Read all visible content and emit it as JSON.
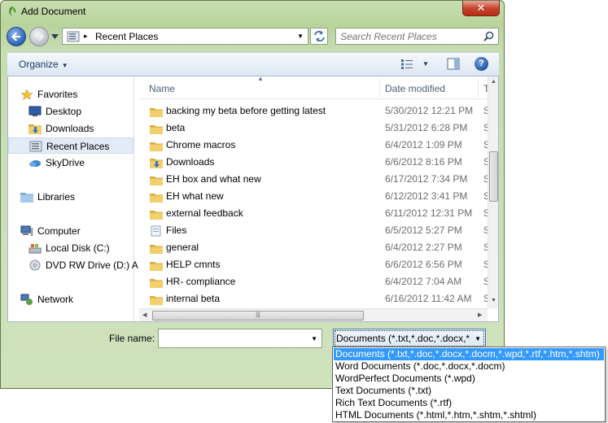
{
  "window": {
    "title": "Add Document",
    "close_label": "✕"
  },
  "address": {
    "path": "Recent Places",
    "separator": "▸"
  },
  "search": {
    "placeholder": "Search Recent Places"
  },
  "toolbar": {
    "organize_label": "Organize",
    "help_label": "?"
  },
  "nav": {
    "items": [
      {
        "label": "Favorites",
        "icon": "star-icon"
      },
      {
        "label": "Desktop",
        "icon": "desktop-icon"
      },
      {
        "label": "Downloads",
        "icon": "downloads-folder-icon"
      },
      {
        "label": "Recent Places",
        "icon": "recent-places-icon",
        "selected": true
      },
      {
        "label": "SkyDrive",
        "icon": "skydrive-icon"
      },
      {
        "label": "Libraries",
        "icon": "libraries-icon"
      },
      {
        "label": "Computer",
        "icon": "computer-icon"
      },
      {
        "label": "Local Disk (C:)",
        "icon": "local-disk-icon"
      },
      {
        "label": "DVD RW Drive (D:) A",
        "icon": "dvd-drive-icon"
      },
      {
        "label": "Network",
        "icon": "network-icon"
      }
    ]
  },
  "columns": {
    "name": "Name",
    "date": "Date modified",
    "type": "T"
  },
  "files": [
    {
      "name": "backing my beta before getting latest",
      "date": "5/30/2012 12:21 PM",
      "type": "S",
      "icon": "folder-icon"
    },
    {
      "name": "beta",
      "date": "5/31/2012 6:28 PM",
      "type": "S",
      "icon": "folder-icon"
    },
    {
      "name": "Chrome macros",
      "date": "6/4/2012 1:09 PM",
      "type": "S",
      "icon": "folder-icon"
    },
    {
      "name": "Downloads",
      "date": "6/6/2012 8:16 PM",
      "type": "S",
      "icon": "downloads-folder-icon"
    },
    {
      "name": "EH box and what new",
      "date": "6/17/2012 7:34 PM",
      "type": "S",
      "icon": "folder-icon"
    },
    {
      "name": "EH what new",
      "date": "6/12/2012 3:41 PM",
      "type": "S",
      "icon": "folder-icon"
    },
    {
      "name": "external feedback",
      "date": "6/11/2012 12:31 PM",
      "type": "S",
      "icon": "folder-icon"
    },
    {
      "name": "Files",
      "date": "6/5/2012 5:27 PM",
      "type": "S",
      "icon": "files-icon"
    },
    {
      "name": "general",
      "date": "6/4/2012 2:27 PM",
      "type": "S",
      "icon": "folder-icon"
    },
    {
      "name": "HELP cmnts",
      "date": "6/6/2012 6:56 PM",
      "type": "S",
      "icon": "folder-icon"
    },
    {
      "name": "HR- compliance",
      "date": "6/4/2012 7:04 AM",
      "type": "S",
      "icon": "folder-icon"
    },
    {
      "name": "internal beta",
      "date": "6/16/2012 11:42 AM",
      "type": "S",
      "icon": "folder-icon"
    }
  ],
  "filename": {
    "label": "File name:",
    "value": ""
  },
  "filetype": {
    "selected": "Documents (*.txt,*.doc,*.docx,*",
    "options": [
      "Documents (*.txt,*.doc,*.docx,*.docm,*.wpd,*.rtf,*.htm,*.shtm)",
      "Word Documents (*.doc,*.docx,*.docm)",
      "WordPerfect Documents (*.wpd)",
      "Text Documents (*.txt)",
      "Rich Text Documents (*.rtf)",
      "HTML Documents (*.html,*.htm,*.shtm,*.shtml)"
    ],
    "highlighted_index": 0
  },
  "colors": {
    "selection": "#3399ff",
    "frame": "#c6dcb1",
    "folder": "#e8c05a"
  }
}
